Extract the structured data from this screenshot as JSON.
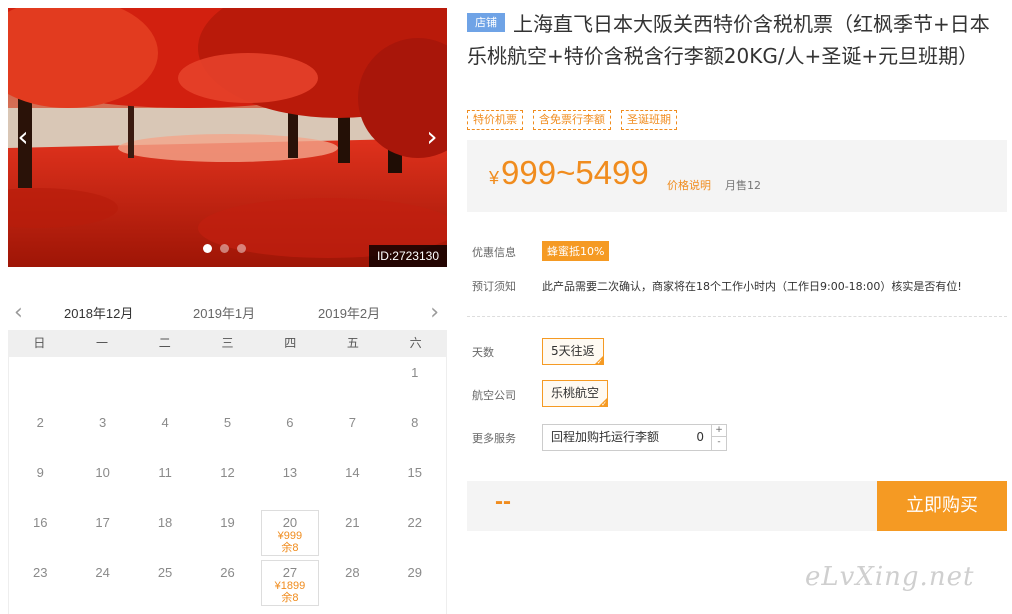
{
  "gallery": {
    "prev_arrow": "‹",
    "next_arrow": "›",
    "image_id": "ID:2723130",
    "slide_count": 3,
    "active_slide": 1
  },
  "calendar": {
    "prev_arrow": "‹",
    "next_arrow": "›",
    "months": [
      "2018年12月",
      "2019年1月",
      "2019年2月"
    ],
    "active_month": 0,
    "weekdays": [
      "日",
      "一",
      "二",
      "三",
      "四",
      "五",
      "六"
    ],
    "weeks": [
      [
        {
          "day": ""
        },
        {
          "day": ""
        },
        {
          "day": ""
        },
        {
          "day": ""
        },
        {
          "day": ""
        },
        {
          "day": ""
        },
        {
          "day": "1"
        }
      ],
      [
        {
          "day": "2"
        },
        {
          "day": "3"
        },
        {
          "day": "4"
        },
        {
          "day": "5"
        },
        {
          "day": "6"
        },
        {
          "day": "7"
        },
        {
          "day": "8"
        }
      ],
      [
        {
          "day": "9"
        },
        {
          "day": "10"
        },
        {
          "day": "11"
        },
        {
          "day": "12"
        },
        {
          "day": "13"
        },
        {
          "day": "14"
        },
        {
          "day": "15"
        }
      ],
      [
        {
          "day": "16"
        },
        {
          "day": "17"
        },
        {
          "day": "18"
        },
        {
          "day": "19"
        },
        {
          "day": "20",
          "price": "¥999",
          "stock": "余8"
        },
        {
          "day": "21"
        },
        {
          "day": "22"
        }
      ],
      [
        {
          "day": "23"
        },
        {
          "day": "24"
        },
        {
          "day": "25"
        },
        {
          "day": "26"
        },
        {
          "day": "27",
          "price": "¥1899",
          "stock": "余8"
        },
        {
          "day": "28"
        },
        {
          "day": "29"
        }
      ]
    ]
  },
  "product": {
    "shop_badge": "店铺",
    "title": "上海直飞日本大阪关西特价含税机票（红枫季节+日本乐桃航空+特价含税含行李额20KG/人+圣诞+元旦班期）",
    "tags": [
      "特价机票",
      "含免票行李额",
      "圣诞班期"
    ],
    "price": {
      "currency": "¥",
      "range": "999~5499",
      "note_link": "价格说明",
      "monthly_sales": "月售12"
    },
    "promo_label": "优惠信息",
    "promo_badge": "蜂蜜抵10%",
    "notice_label": "预订须知",
    "notice_text": "此产品需要二次确认，商家将在18个工作小时内（工作日9:00-18:00）核实是否有位!",
    "options": {
      "days_label": "天数",
      "days_value": "5天往返",
      "airline_label": "航空公司",
      "airline_value": "乐桃航空",
      "service_label": "更多服务",
      "service_name": "回程加购托运行李额",
      "service_qty": "0",
      "plus": "+",
      "minus": "-"
    },
    "total": "--",
    "buy_button": "立即购买"
  },
  "watermark": "eLvXing.net",
  "colors": {
    "accent": "#f59a23",
    "price": "#f08c1e",
    "badge": "#6fa3e6"
  }
}
